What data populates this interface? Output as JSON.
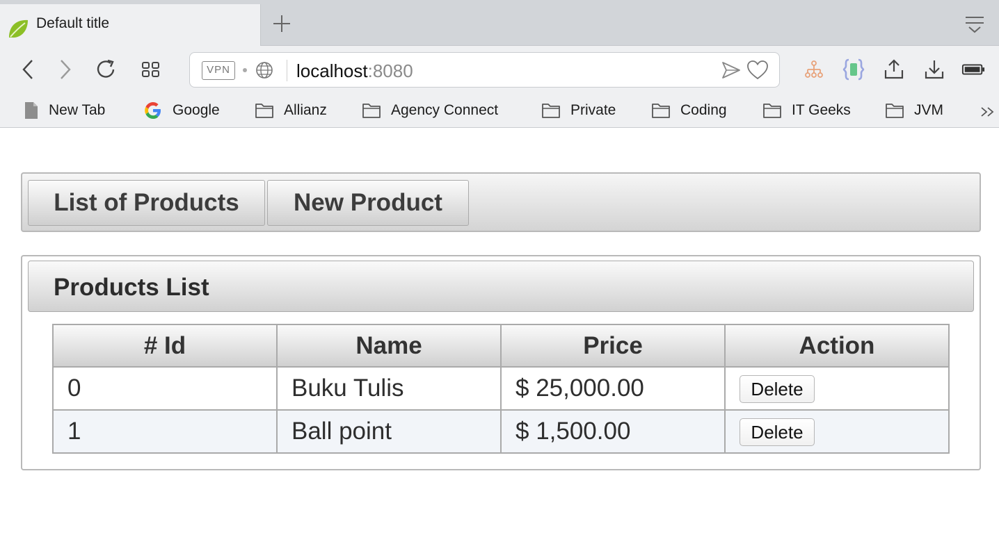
{
  "browser": {
    "tab": {
      "title": "Default title",
      "icon": "spring-leaf-icon"
    },
    "url": {
      "host": "localhost",
      "port": ":8080"
    },
    "vpn_label": "VPN",
    "bookmarks": [
      {
        "label": "New Tab",
        "icon": "page-icon"
      },
      {
        "label": "Google",
        "icon": "google-icon"
      },
      {
        "label": "Allianz",
        "icon": "folder-icon"
      },
      {
        "label": "Agency Connect",
        "icon": "folder-icon"
      },
      {
        "label": "Private",
        "icon": "folder-icon"
      },
      {
        "label": "Coding",
        "icon": "folder-icon"
      },
      {
        "label": "IT Geeks",
        "icon": "folder-icon"
      },
      {
        "label": "JVM",
        "icon": "folder-icon"
      }
    ],
    "bookmarks_overflow": "»"
  },
  "page": {
    "menu": {
      "list_products": "List of Products",
      "new_product": "New Product"
    },
    "panel_title": "Products List",
    "table": {
      "headers": [
        "# Id",
        "Name",
        "Price",
        "Action"
      ],
      "rows": [
        {
          "id": "0",
          "name": "Buku Tulis",
          "price": "$ 25,000.00",
          "action": "Delete"
        },
        {
          "id": "1",
          "name": "Ball point",
          "price": "$ 1,500.00",
          "action": "Delete"
        }
      ]
    }
  },
  "colors": {
    "chrome_bg": "#eff0f2",
    "tabstrip_bg": "#d2d5d9",
    "panel_border": "#b9b9b9",
    "alt_row": "#f2f5f9"
  }
}
